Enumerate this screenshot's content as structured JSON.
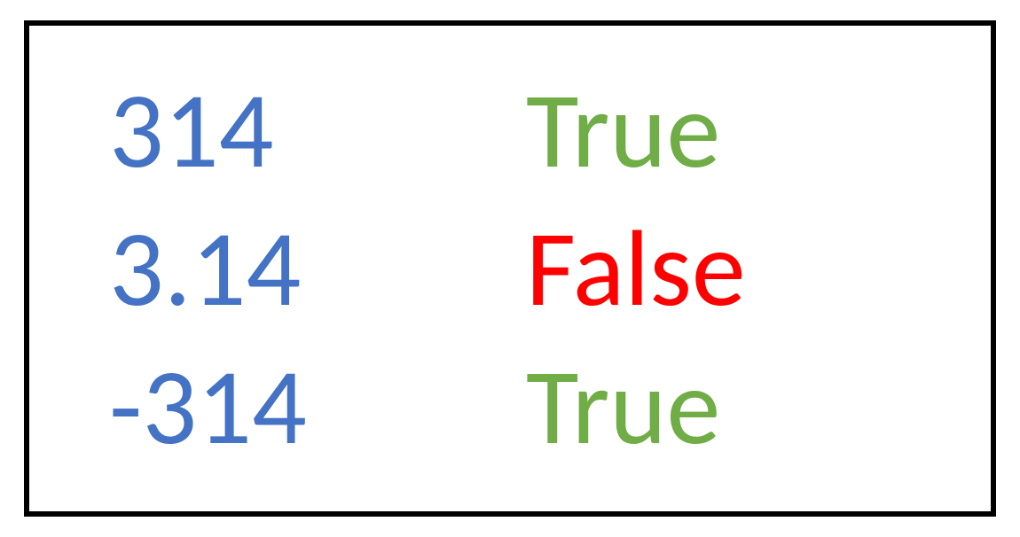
{
  "rows": [
    {
      "value": "314",
      "result": "True",
      "valueColor": "blue",
      "resultColor": "green"
    },
    {
      "value": "3.14",
      "result": "False",
      "valueColor": "blue",
      "resultColor": "red"
    },
    {
      "value": "-314",
      "result": "True",
      "valueColor": "blue",
      "resultColor": "green"
    }
  ],
  "colors": {
    "blue": "#4472C4",
    "green": "#70AD47",
    "red": "#FF0000"
  }
}
